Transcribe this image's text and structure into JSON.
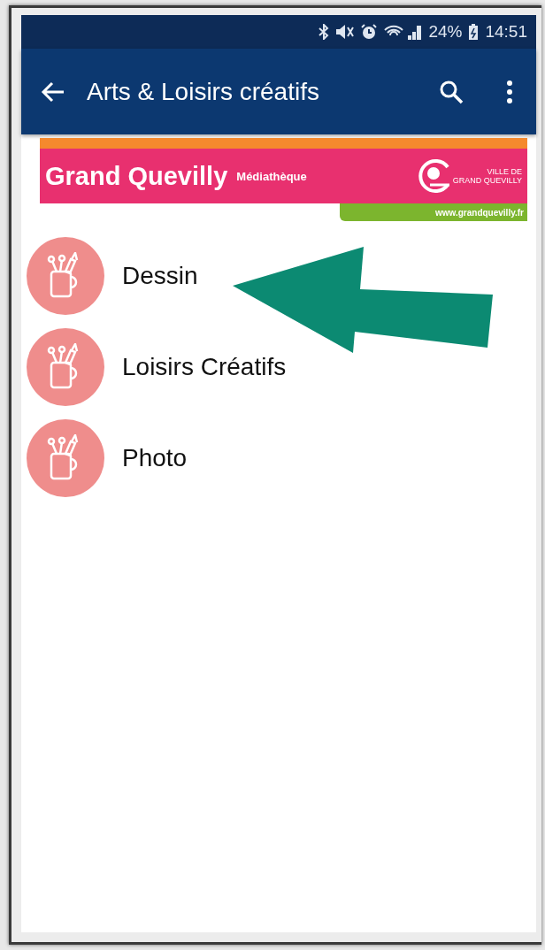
{
  "status_bar": {
    "battery": "24%",
    "time": "14:51"
  },
  "app_bar": {
    "title": "Arts & Loisirs créatifs"
  },
  "banner": {
    "name": "Grand Quevilly",
    "subtitle": "Médiathèque",
    "logo_line_1": "VILLE DE",
    "logo_line_2": "GRAND QUEVILLY",
    "url": "www.grandquevilly.fr"
  },
  "categories": [
    {
      "label": "Dessin"
    },
    {
      "label": "Loisirs Créatifs"
    },
    {
      "label": "Photo"
    }
  ]
}
